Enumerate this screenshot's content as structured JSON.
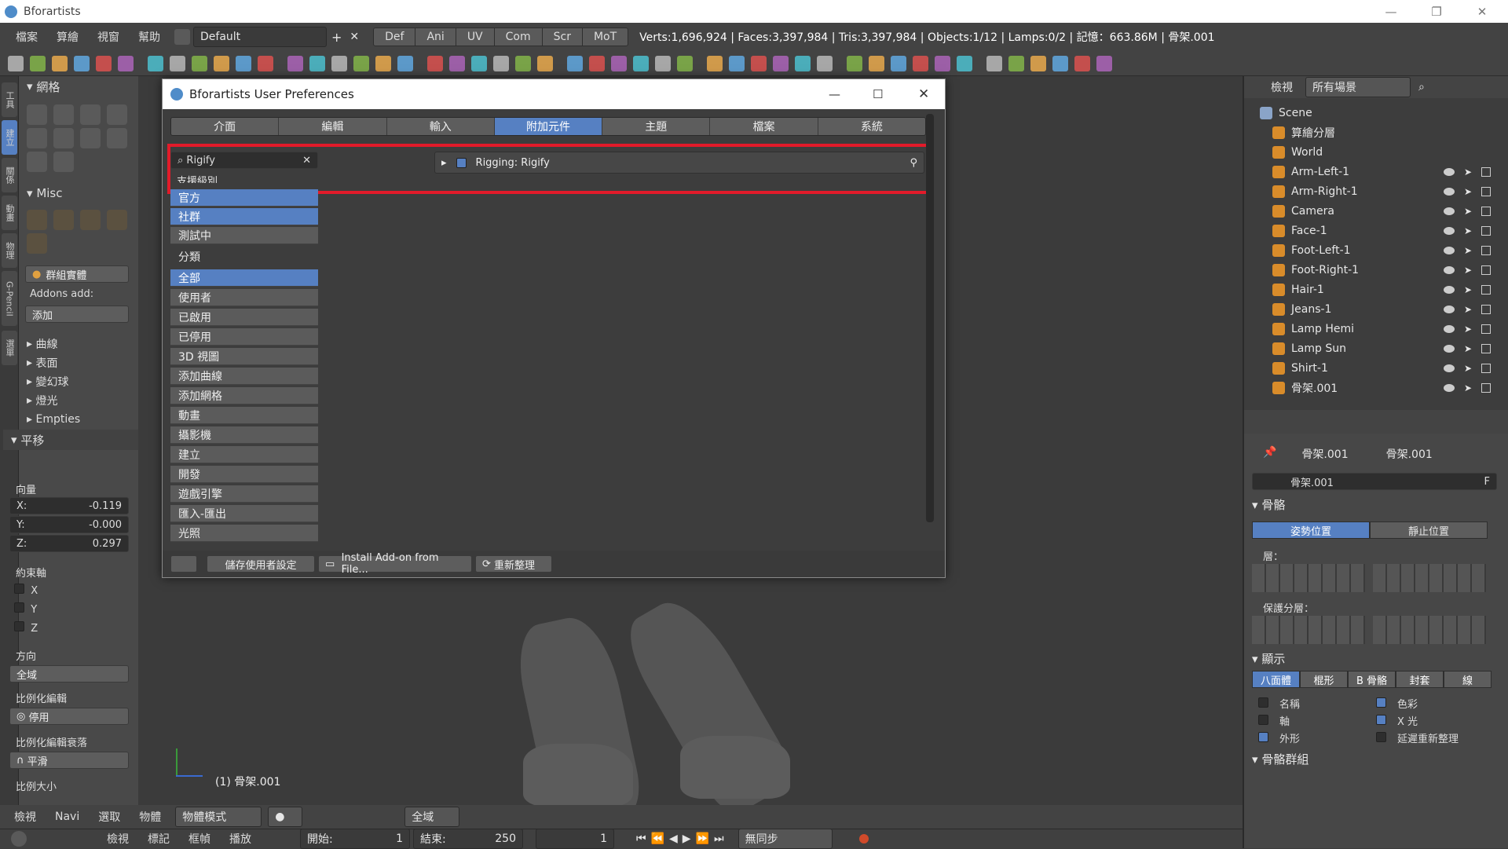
{
  "window": {
    "title": "Bforartists",
    "minimize": "—",
    "restore": "❐",
    "close": "✕"
  },
  "infobar": {
    "menus": [
      "檔案",
      "算繪",
      "視窗",
      "幫助"
    ],
    "screen_layout": "Default",
    "add": "+",
    "remove": "✕",
    "modes": [
      "Def",
      "Ani",
      "UV",
      "Com",
      "Scr",
      "MoT"
    ],
    "stats": "Verts:1,696,924 | Faces:3,397,984 | Tris:3,397,984 | Objects:1/12 | Lamps:0/2 | 記憶：663.86M | 骨架.001"
  },
  "lefttabs": [
    "工具",
    "建立",
    "關係",
    "動畫",
    "物理",
    "G-Pencil",
    "選單"
  ],
  "toolshelf": {
    "mesh_header": "網格",
    "misc_header": "Misc",
    "group_instance": "群組實體",
    "addons_add_label": "Addons add:",
    "addons_add_value": "添加",
    "sections": [
      "曲線",
      "表面",
      "變幻球",
      "燈光",
      "Empties"
    ],
    "translate_header": "平移",
    "vector_label": "向量",
    "x": {
      "label": "X:",
      "value": "-0.119"
    },
    "y": {
      "label": "Y:",
      "value": "-0.000"
    },
    "z": {
      "label": "Z:",
      "value": "0.297"
    },
    "constraint_label": "約束軸",
    "axes": [
      "X",
      "Y",
      "Z"
    ],
    "orientation_label": "方向",
    "orientation_value": "全域",
    "prop_edit_label": "比例化編輯",
    "prop_edit_value": "停用",
    "prop_falloff_label": "比例化編輯衰落",
    "prop_falloff_value": "平滑",
    "prop_size_label": "比例大小"
  },
  "viewport": {
    "object_label": "(1) 骨架.001"
  },
  "viewport_header": {
    "menus": [
      "檢視",
      "Navi",
      "選取",
      "物體"
    ],
    "mode": "物體模式",
    "pivot_space": "全域"
  },
  "timeline": {
    "menus": [
      "檢視",
      "標記",
      "框幀",
      "播放"
    ],
    "start_label": "開始:",
    "start_value": "1",
    "end_label": "結束:",
    "end_value": "250",
    "current": "1",
    "sync": "無同步"
  },
  "outliner": {
    "view_label": "檢視",
    "filter": "所有場景",
    "items": [
      {
        "name": "Scene",
        "level": 0
      },
      {
        "name": "算繪分層",
        "level": 1
      },
      {
        "name": "World",
        "level": 1
      },
      {
        "name": "Arm-Left-1",
        "level": 1
      },
      {
        "name": "Arm-Right-1",
        "level": 1
      },
      {
        "name": "Camera",
        "level": 1
      },
      {
        "name": "Face-1",
        "level": 1
      },
      {
        "name": "Foot-Left-1",
        "level": 1
      },
      {
        "name": "Foot-Right-1",
        "level": 1
      },
      {
        "name": "Hair-1",
        "level": 1
      },
      {
        "name": "Jeans-1",
        "level": 1
      },
      {
        "name": "Lamp Hemi",
        "level": 1
      },
      {
        "name": "Lamp Sun",
        "level": 1
      },
      {
        "name": "Shirt-1",
        "level": 1
      },
      {
        "name": "骨架.001",
        "level": 1
      }
    ]
  },
  "properties": {
    "breadcrumb_object": "骨架.001",
    "breadcrumb_data": "骨架.001",
    "datablock": "骨架.001",
    "fake_user": "F",
    "skeleton_header": "骨骼",
    "pose_position": "姿勢位置",
    "rest_position": "靜止位置",
    "layers_label": "層：",
    "protected_layers_label": "保護分層：",
    "display_header": "顯示",
    "display_modes": [
      "八面體",
      "棍形",
      "B 骨骼",
      "封套",
      "線"
    ],
    "options_left": [
      {
        "label": "名稱",
        "checked": false
      },
      {
        "label": "軸",
        "checked": false
      },
      {
        "label": "外形",
        "checked": true
      }
    ],
    "options_right": [
      {
        "label": "色彩",
        "checked": true
      },
      {
        "label": "X 光",
        "checked": true
      },
      {
        "label": "延遲重新整理",
        "checked": false
      }
    ],
    "bone_groups_header": "骨骼群組"
  },
  "dialog": {
    "title": "Bforartists User Preferences",
    "tabs": [
      "介面",
      "編輯",
      "輸入",
      "附加元件",
      "主題",
      "檔案",
      "系統"
    ],
    "active_tab": "附加元件",
    "search_value": "Rigify",
    "support_level_label": "支援級別",
    "support": [
      "官方",
      "社群",
      "測試中"
    ],
    "category_label": "分類",
    "categories": [
      "全部",
      "使用者",
      "已啟用",
      "已停用",
      "3D 視圖",
      "添加曲線",
      "添加網格",
      "動畫",
      "攝影機",
      "建立",
      "開發",
      "遊戲引擎",
      "匯入-匯出",
      "光照"
    ],
    "addon_name": "Rigging: Rigify",
    "addon_enabled": true,
    "save_settings": "儲存使用者設定",
    "install_addon": "Install Add-on from File...",
    "refresh": "重新整理"
  }
}
